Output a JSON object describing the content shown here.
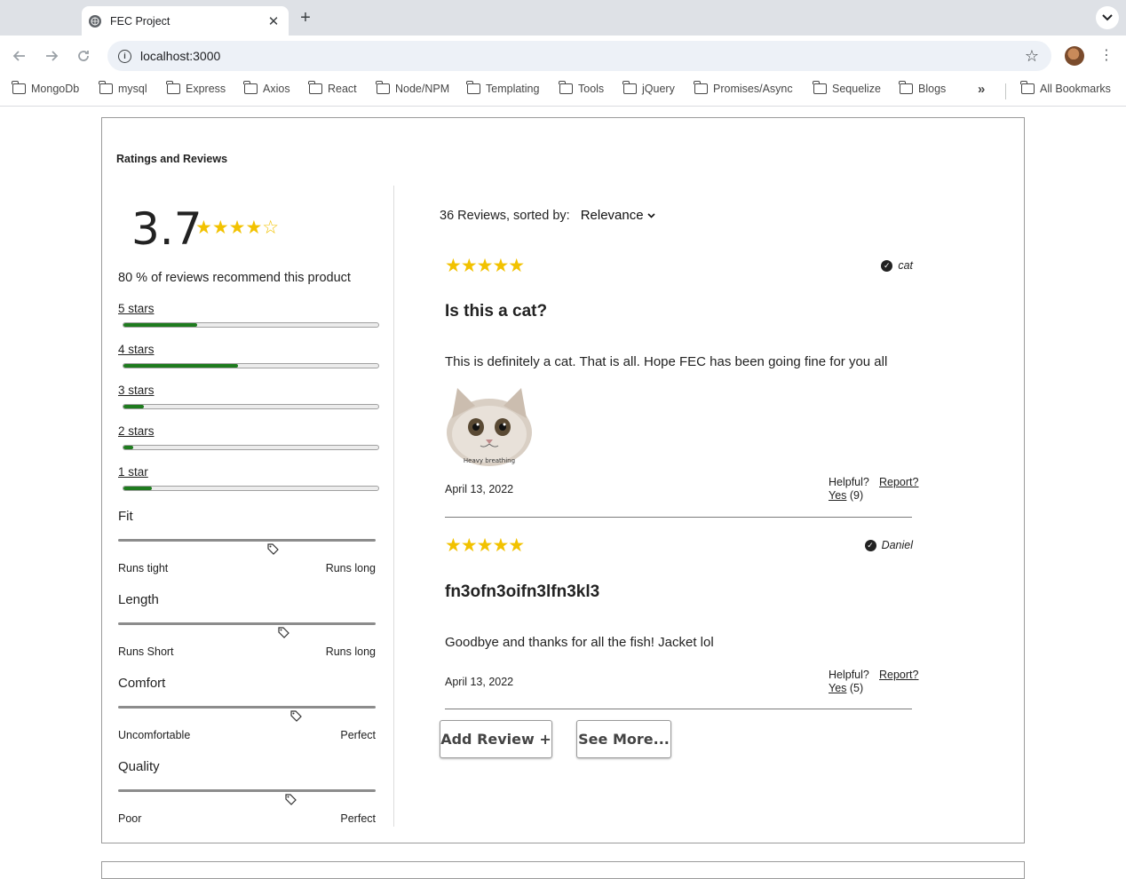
{
  "browser": {
    "tab_title": "FEC Project",
    "tab_close": "✕",
    "new_tab": "+",
    "url": "localhost:3000",
    "info_icon": "i",
    "bookmarks": [
      "MongoDb",
      "mysql",
      "Express",
      "Axios",
      "React",
      "Node/NPM",
      "Templating",
      "Tools",
      "jQuery",
      "Promises/Async",
      "Sequelize",
      "Blogs"
    ],
    "bookmarks_more": "»",
    "all_bookmarks": "All Bookmarks"
  },
  "section": {
    "title": "Ratings and Reviews"
  },
  "summary": {
    "average": "3.7",
    "average_stars": "★★★★☆",
    "average_rating_value": 3.7,
    "recommend_text": "80 % of reviews recommend this product",
    "breakdown": [
      {
        "label": "5 stars",
        "fraction": 0.29
      },
      {
        "label": "4 stars",
        "fraction": 0.45
      },
      {
        "label": "3 stars",
        "fraction": 0.08
      },
      {
        "label": "2 stars",
        "fraction": 0.04
      },
      {
        "label": "1 star",
        "fraction": 0.11
      }
    ],
    "characteristics": [
      {
        "name": "Fit",
        "low": "Runs tight",
        "high": "Runs long",
        "value": 0.6
      },
      {
        "name": "Length",
        "low": "Runs Short",
        "high": "Runs long",
        "value": 0.64
      },
      {
        "name": "Comfort",
        "low": "Uncomfortable",
        "high": "Perfect",
        "value": 0.69
      },
      {
        "name": "Quality",
        "low": "Poor",
        "high": "Perfect",
        "value": 0.67
      }
    ]
  },
  "reviews_list": {
    "count_text": "36 Reviews, sorted by:",
    "sort_value": "Relevance",
    "reviews": [
      {
        "stars": "★★★★★",
        "user": "cat",
        "title": "Is this a cat?",
        "body": "This is definitely a cat. That is all. Hope FEC has been going fine for you all",
        "photo_caption": "Heavy breathing",
        "date": "April 13, 2022",
        "helpful_label": "Helpful?",
        "yes_label": "Yes",
        "yes_count": "(9)",
        "report_label": "Report?"
      },
      {
        "stars": "★★★★★",
        "user": "Daniel",
        "title": "fn3ofn3oifn3lfn3kl3",
        "body": "Goodbye and thanks for all the fish! Jacket lol",
        "date": "April 13, 2022",
        "helpful_label": "Helpful?",
        "yes_label": "Yes",
        "yes_count": "(5)",
        "report_label": "Report?"
      }
    ],
    "add_review_label": "Add Review +",
    "see_more_label": "See More..."
  }
}
